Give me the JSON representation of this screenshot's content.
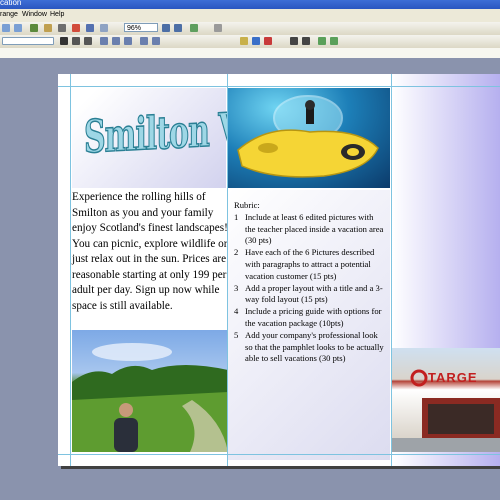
{
  "window": {
    "title": "cation"
  },
  "menu": {
    "items": [
      "range",
      "Window",
      "Help"
    ]
  },
  "toolbar": {
    "zoom": "96%"
  },
  "flyer": {
    "title": "Smilton Vacations",
    "body": "Experience the rolling hills of Smilton as you and your family enjoy Scotland's finest landscapes!  You can picnic, explore wildlife or just relax out in the sun.  Prices are reasonable starting at only 199 per adult per day.  Sign up now while space is still available.",
    "rubric_heading": "Rubric:",
    "rubric_items": [
      {
        "num": "1",
        "text": "Include at least 6 edited pictures with the teacher placed inside a vacation area (30 pts)"
      },
      {
        "num": "2",
        "text": "Have each of the 6 Pictures described with paragraphs to attract a potential vacation customer (15 pts)"
      },
      {
        "num": "3",
        "text": "Add a proper layout with a title and a 3-way fold layout (15 pts)"
      },
      {
        "num": "4",
        "text": "Include a pricing guide with options for the vacation package (10pts)"
      },
      {
        "num": "5",
        "text": "Add your company's professional look so that the pamphlet looks to be actually able to sell vacations (30 pts)"
      }
    ],
    "store_sign": "TARGE"
  }
}
